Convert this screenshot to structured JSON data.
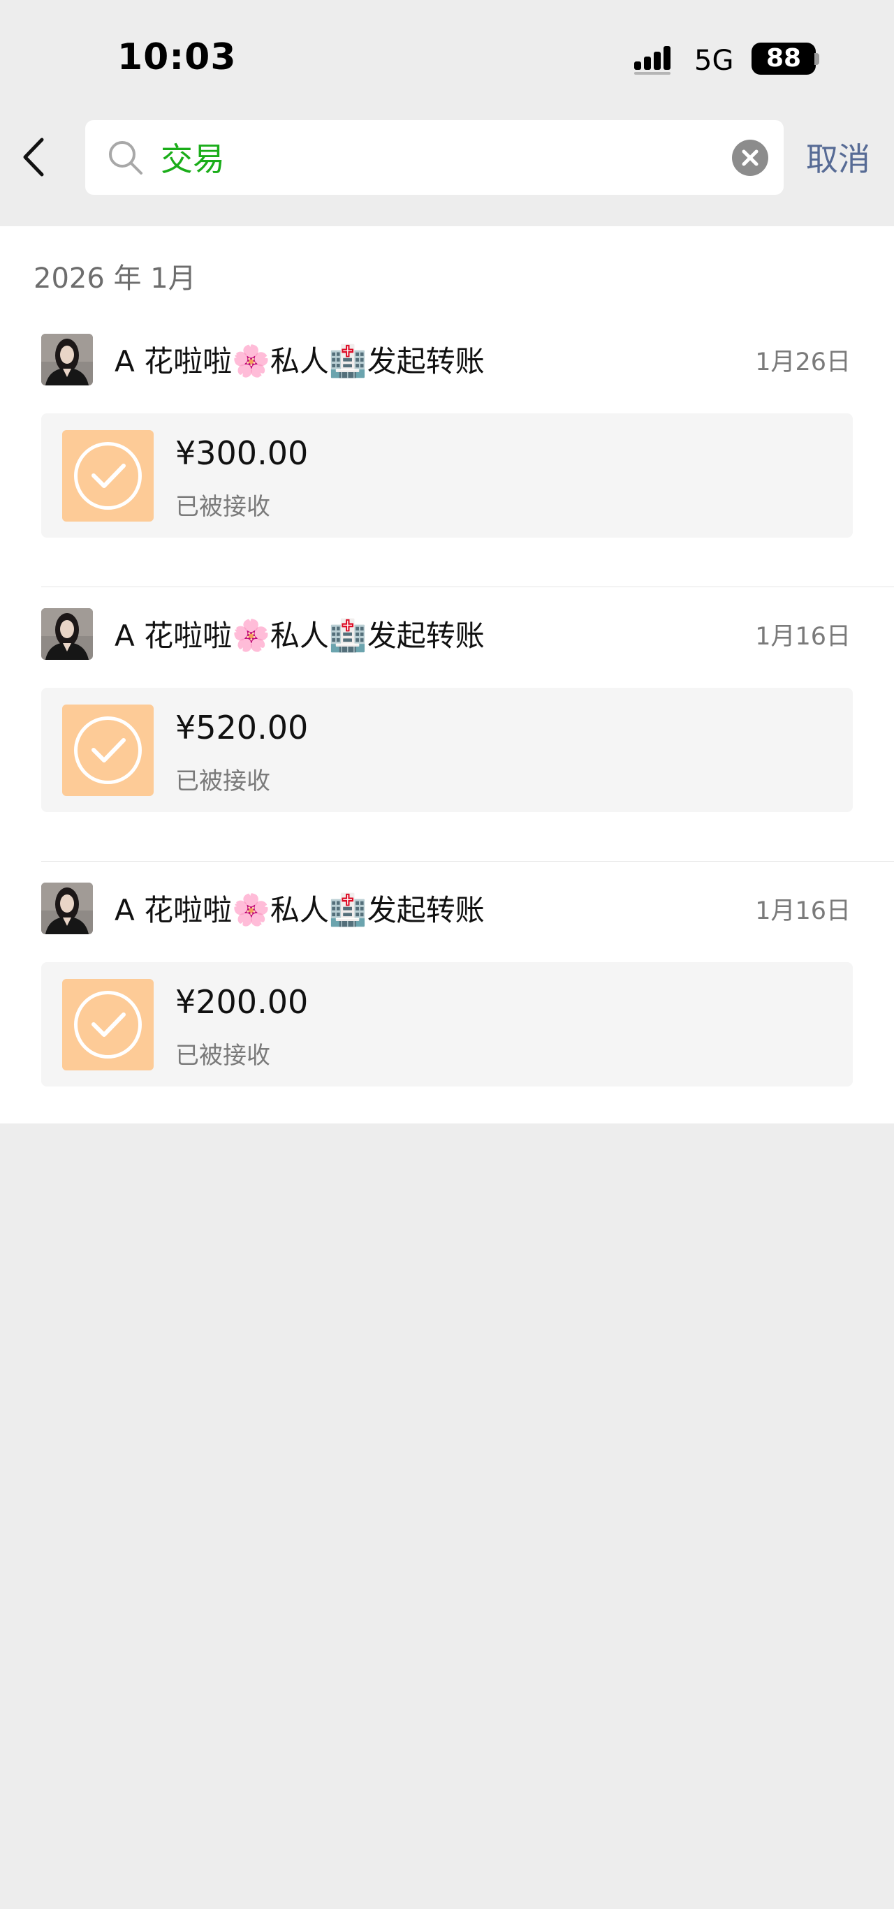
{
  "status_bar": {
    "time": "10:03",
    "network": "5G",
    "battery": "88"
  },
  "search": {
    "query": "交易",
    "cancel_label": "取消"
  },
  "results": {
    "month_label": "2026 年 1月",
    "records": [
      {
        "sender": "A 花啦啦",
        "emoji_1": "🌸",
        "middle": "私人",
        "emoji_2": "🏥",
        "action": "发起转账",
        "date": "1月26日",
        "amount": "¥300.00",
        "status": "已被接收"
      },
      {
        "sender": "A 花啦啦",
        "emoji_1": "🌸",
        "middle": "私人",
        "emoji_2": "🏥",
        "action": "发起转账",
        "date": "1月16日",
        "amount": "¥520.00",
        "status": "已被接收"
      },
      {
        "sender": "A 花啦啦",
        "emoji_1": "🌸",
        "middle": "私人",
        "emoji_2": "🏥",
        "action": "发起转账",
        "date": "1月16日",
        "amount": "¥200.00",
        "status": "已被接收"
      }
    ]
  },
  "colors": {
    "page_background": "#ededed",
    "panel_background": "#ffffff",
    "card_background": "#f5f5f5",
    "transfer_icon_background": "#fdcb97",
    "search_query_text": "#1aad19",
    "cancel_link": "#576b95"
  },
  "icons": {
    "back": "chevron-left-icon",
    "search": "search-icon",
    "clear": "clear-icon",
    "transfer": "check-circle-icon",
    "signal": "signal-icon"
  }
}
